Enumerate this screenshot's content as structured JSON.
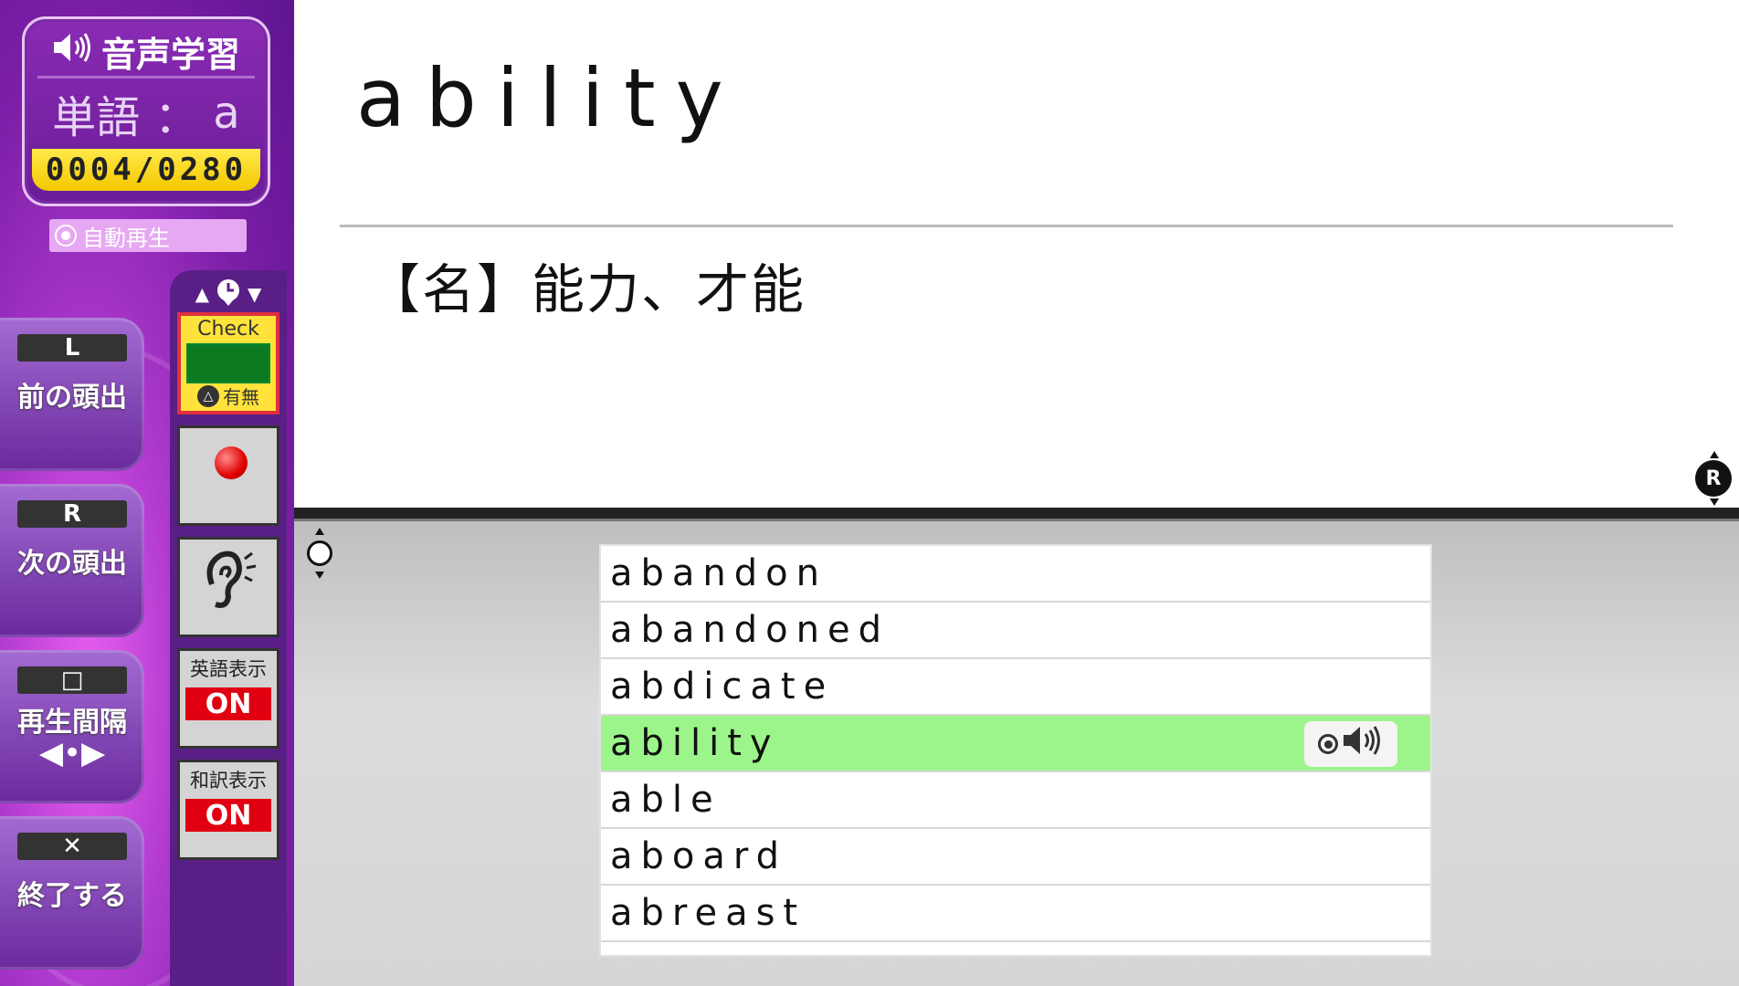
{
  "app": {
    "title": "音声学習",
    "speaker_icon": "speaker-icon",
    "word_label": "単語",
    "word_separator": "：",
    "word_initial": "a",
    "counter": "0004/0280",
    "autoplay_label": "自動再生"
  },
  "buttons": {
    "prev": {
      "key": "L",
      "label": "前の頭出"
    },
    "next": {
      "key": "R",
      "label": "次の頭出"
    },
    "interval": {
      "key": "□",
      "label": "再生間隔",
      "arrows": "◀•▶"
    },
    "quit": {
      "key": "✕",
      "label": "終了する"
    }
  },
  "tools": {
    "bookmark_nav": {
      "up": "▲",
      "down": "▼"
    },
    "check": {
      "label": "Check",
      "sub_key": "△",
      "sub_label": "有無"
    },
    "english_display": {
      "label": "英語表示",
      "value": "ON"
    },
    "japanese_display": {
      "label": "和訳表示",
      "value": "ON"
    }
  },
  "main": {
    "word": "ability",
    "meaning": "【名】能力、才能",
    "r_marker": "R"
  },
  "word_list": {
    "items": [
      "abandon",
      "abandoned",
      "abdicate",
      "ability",
      "able",
      "aboard",
      "abreast"
    ],
    "selected_index": 3
  },
  "colors": {
    "selected_row": "#9cf58a",
    "counter_bg": "#ffe23a",
    "toggle_on": "#e00012",
    "sidebar": "#8a2bb4"
  }
}
